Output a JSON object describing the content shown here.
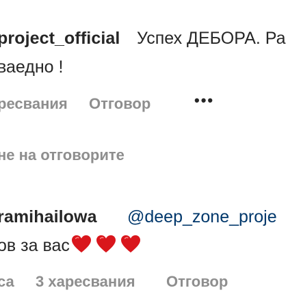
{
  "comment1": {
    "username": "project_official",
    "text_line1": "Успех ДЕБОРА. Ра",
    "text_line2": "ваедно !",
    "meta_likes": "ресвания",
    "meta_reply": "Отговор",
    "more": "•••"
  },
  "replies_toggle": "не на отговорите",
  "comment2": {
    "username": "ramihailowa",
    "mention": "@deep_zone_proje",
    "text_line2": "ов за вас",
    "hearts": [
      "red-heart-emoji",
      "red-heart-emoji",
      "red-heart-emoji"
    ],
    "meta_time": "са",
    "meta_likes": "3 харесвания",
    "meta_reply": "Отговор"
  },
  "colors": {
    "heart": "#d9161c",
    "mention": "#00376b",
    "secondary_text": "#8e8e8e",
    "primary_text": "#262626"
  }
}
